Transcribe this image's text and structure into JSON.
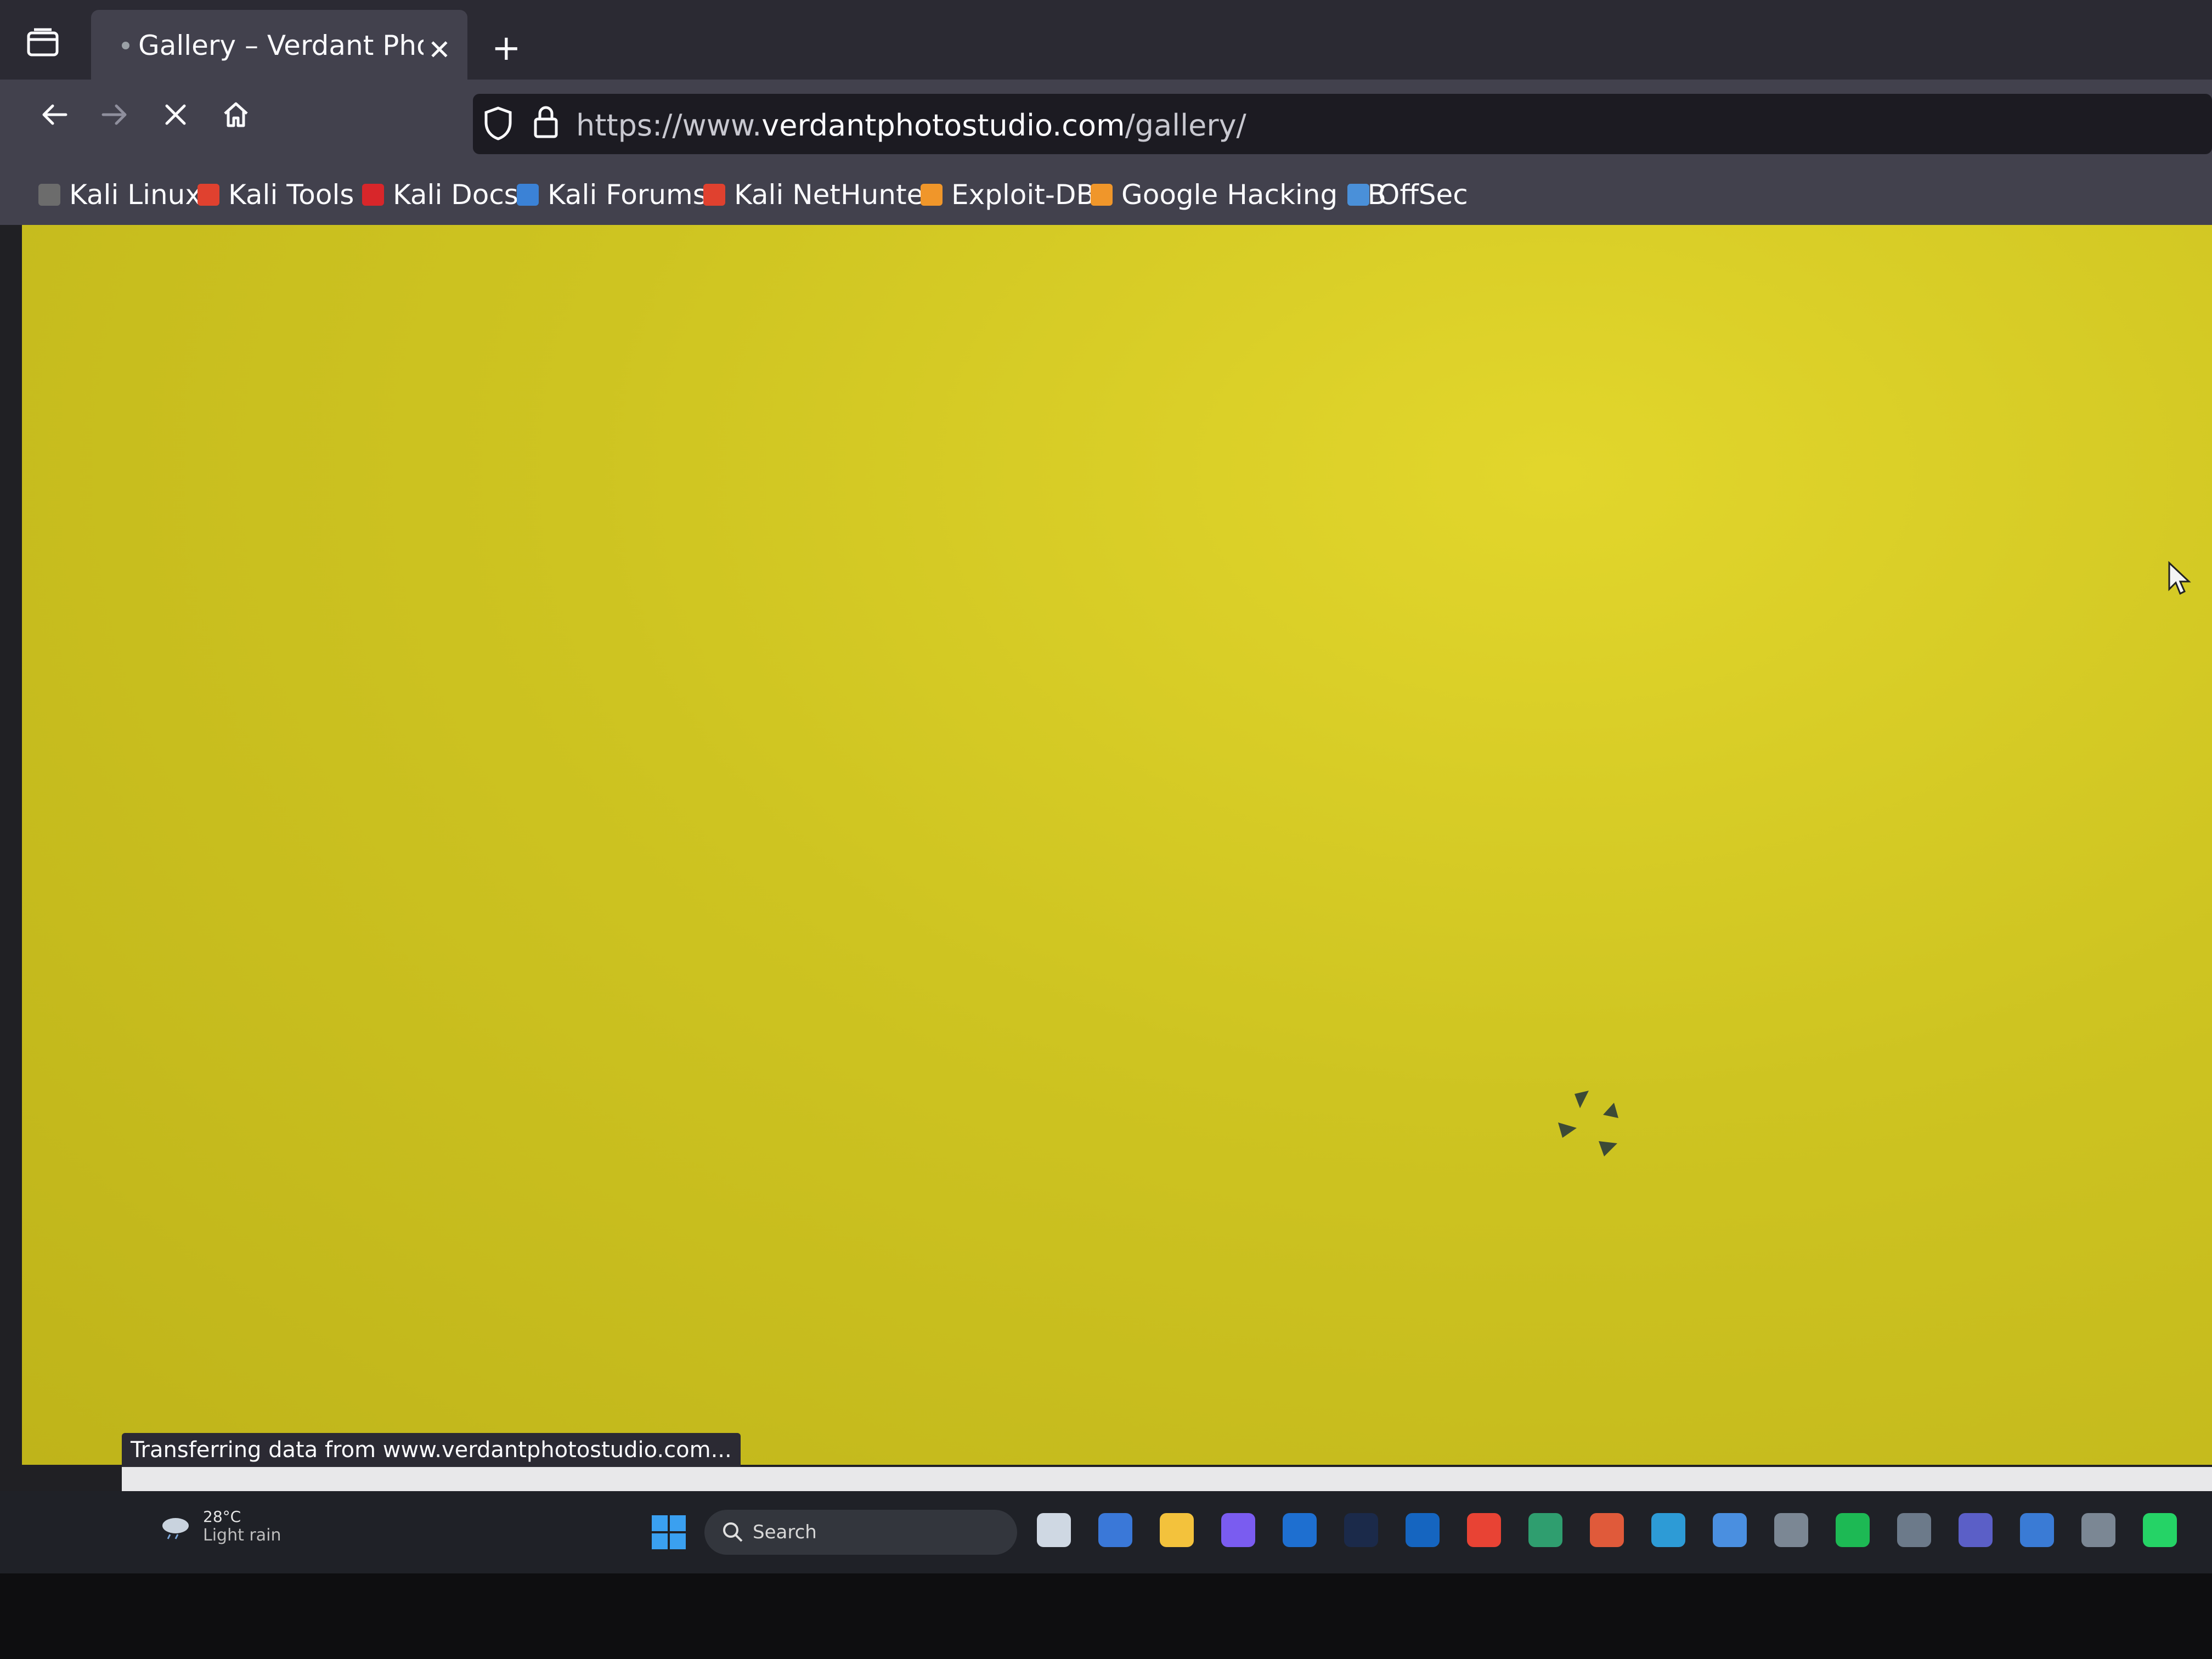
{
  "tab": {
    "title": "Gallery – Verdant Photo S"
  },
  "toolbar": {
    "new_tab": "+"
  },
  "url": {
    "scheme_prefix": "https://www.",
    "domain": "verdantphotostudio.com",
    "path": "/gallery/"
  },
  "bookmarks": [
    {
      "label": "Kali Linux",
      "icon": "kali-dragon-icon",
      "color": "#6c6c6c"
    },
    {
      "label": "Kali Tools",
      "icon": "kali-tools-icon",
      "color": "#e0412f"
    },
    {
      "label": "Kali Docs",
      "icon": "kali-docs-icon",
      "color": "#d8262a"
    },
    {
      "label": "Kali Forums",
      "icon": "kali-forums-icon",
      "color": "#3b82d6"
    },
    {
      "label": "Kali NetHunter",
      "icon": "kali-nethunter-icon",
      "color": "#e0412f"
    },
    {
      "label": "Exploit-DB",
      "icon": "exploit-db-icon",
      "color": "#f0962a"
    },
    {
      "label": "Google Hacking DB",
      "icon": "ghdb-icon",
      "color": "#f0962a"
    },
    {
      "label": "OffSec",
      "icon": "offsec-icon",
      "color": "#4a90d9"
    }
  ],
  "page": {
    "background_color": "#cdc21e"
  },
  "status": {
    "text": "Transferring data from www.verdantphotostudio.com..."
  },
  "taskbar": {
    "weather_temp": "28°C",
    "weather_desc": "Light rain",
    "search_label": "Search",
    "apps": [
      {
        "name": "task-view-icon",
        "color": "#cfd8e3"
      },
      {
        "name": "store-icon",
        "color": "#3a78d8"
      },
      {
        "name": "file-explorer-icon",
        "color": "#f3c23c"
      },
      {
        "name": "copilot-icon",
        "color": "#7a5cf0"
      },
      {
        "name": "outlook-icon",
        "color": "#1e6fd0"
      },
      {
        "name": "photoshop-icon",
        "color": "#1b2a4a"
      },
      {
        "name": "outlook-classic-icon",
        "color": "#1565c0"
      },
      {
        "name": "chrome-icon",
        "color": "#e84334"
      },
      {
        "name": "app-icon",
        "color": "#2f9e6f"
      },
      {
        "name": "app-icon",
        "color": "#e05a3a"
      },
      {
        "name": "edge-icon",
        "color": "#2d9bd6"
      },
      {
        "name": "chrome-beta-icon",
        "color": "#4a8fe0"
      },
      {
        "name": "app-icon",
        "color": "#7b8794"
      },
      {
        "name": "spotify-icon",
        "color": "#1db954"
      },
      {
        "name": "photos-icon",
        "color": "#6c7a8a"
      },
      {
        "name": "teams-icon",
        "color": "#5b5fc7"
      },
      {
        "name": "remote-desktop-icon",
        "color": "#3a7bd5"
      },
      {
        "name": "app-icon",
        "color": "#7b8794"
      },
      {
        "name": "whatsapp-icon",
        "color": "#25d366"
      }
    ]
  }
}
